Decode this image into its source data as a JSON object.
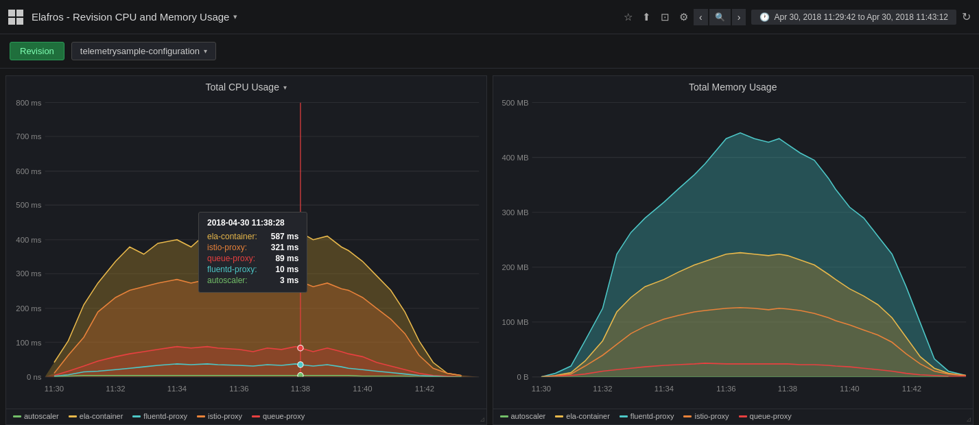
{
  "topbar": {
    "logo_label": "Elafros - Revision CPU and Memory Usage",
    "chevron": "▾",
    "icons": {
      "star": "☆",
      "share": "⎋",
      "save": "💾",
      "gear": "⚙"
    },
    "nav_back": "‹",
    "nav_zoom": "⊖",
    "nav_forward": "›",
    "time_icon": "🕐",
    "time_range": "Apr 30, 2018 11:29:42 to Apr 30, 2018 11:43:12",
    "refresh": "↻"
  },
  "filterbar": {
    "revision_label": "Revision",
    "dropdown_value": "telemetrysample-configuration",
    "dropdown_arrow": "▾"
  },
  "cpu_chart": {
    "title": "Total CPU Usage",
    "title_arrow": "▾",
    "y_labels": [
      "800 ms",
      "700 ms",
      "600 ms",
      "500 ms",
      "400 ms",
      "300 ms",
      "200 ms",
      "100 ms",
      "0 ns"
    ],
    "x_labels": [
      "11:30",
      "11:32",
      "11:34",
      "11:36",
      "11:38",
      "11:40",
      "11:42"
    ]
  },
  "memory_chart": {
    "title": "Total Memory Usage",
    "y_labels": [
      "500 MB",
      "400 MB",
      "300 MB",
      "200 MB",
      "100 MB",
      "0 B"
    ],
    "x_labels": [
      "11:30",
      "11:32",
      "11:34",
      "11:36",
      "11:38",
      "11:40",
      "11:42"
    ]
  },
  "tooltip": {
    "title": "2018-04-30 11:38:28",
    "rows": [
      {
        "label": "ela-container:",
        "value": "587 ms",
        "color": "#e8b84b"
      },
      {
        "label": "istio-proxy:",
        "value": "321 ms",
        "color": "#e8823a"
      },
      {
        "label": "queue-proxy:",
        "value": "89 ms",
        "color": "#e84040"
      },
      {
        "label": "fluentd-proxy:",
        "value": "10 ms",
        "color": "#4dc7c7"
      },
      {
        "label": "autoscaler:",
        "value": "3 ms",
        "color": "#73bf69"
      }
    ]
  },
  "legend": {
    "items": [
      {
        "label": "autoscaler",
        "color": "#73bf69"
      },
      {
        "label": "ela-container",
        "color": "#e8b84b"
      },
      {
        "label": "fluentd-proxy",
        "color": "#4dc7c7"
      },
      {
        "label": "istio-proxy",
        "color": "#e8823a"
      },
      {
        "label": "queue-proxy",
        "color": "#e84040"
      }
    ]
  },
  "colors": {
    "ela_container": "#e8b84b",
    "istio_proxy": "#e8823a",
    "queue_proxy": "#e84040",
    "fluentd_proxy": "#4dc7c7",
    "autoscaler": "#73bf69",
    "grid": "#2c2e33",
    "axis_text": "#888",
    "bg": "#1a1c21",
    "fill_ela": "rgba(180,140,40,0.35)",
    "fill_istio": "rgba(200,100,40,0.3)",
    "fill_queue": "rgba(200,50,50,0.25)"
  }
}
